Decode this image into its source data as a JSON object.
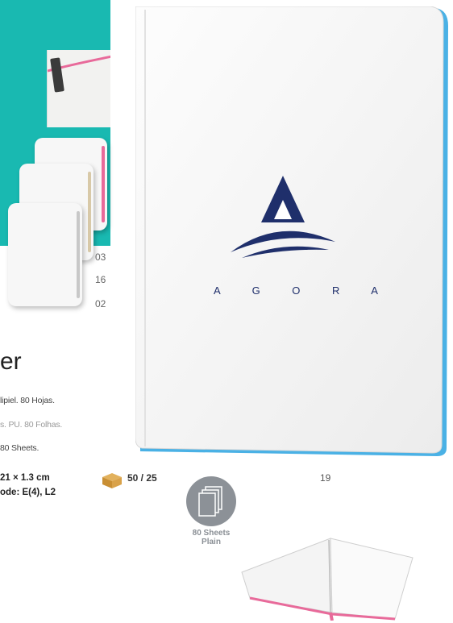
{
  "colors": {
    "teal": "#19b9b1",
    "navy": "#1f2f6b",
    "pink": "#e86a9a",
    "blue_edge": "#2aa3e0"
  },
  "color_codes": {
    "c03": "03",
    "c16": "16",
    "c02": "02",
    "c19": "19"
  },
  "title_fragment": "er",
  "descriptions": {
    "es": "lipiel. 80 Hojas.",
    "pt": "s. PU. 80 Folhas.",
    "en": "80 Sheets."
  },
  "specs": {
    "size": "21 × 1.3 cm",
    "code": "ode: E(4), L2"
  },
  "packing": {
    "icon": "box-icon",
    "value": "50 / 25"
  },
  "badge": {
    "icon": "sheets-icon",
    "line1": "80 Sheets",
    "line2": "Plain"
  },
  "logo": {
    "wordmark": "A G O R A",
    "icon": "agora-triangle-logo"
  }
}
